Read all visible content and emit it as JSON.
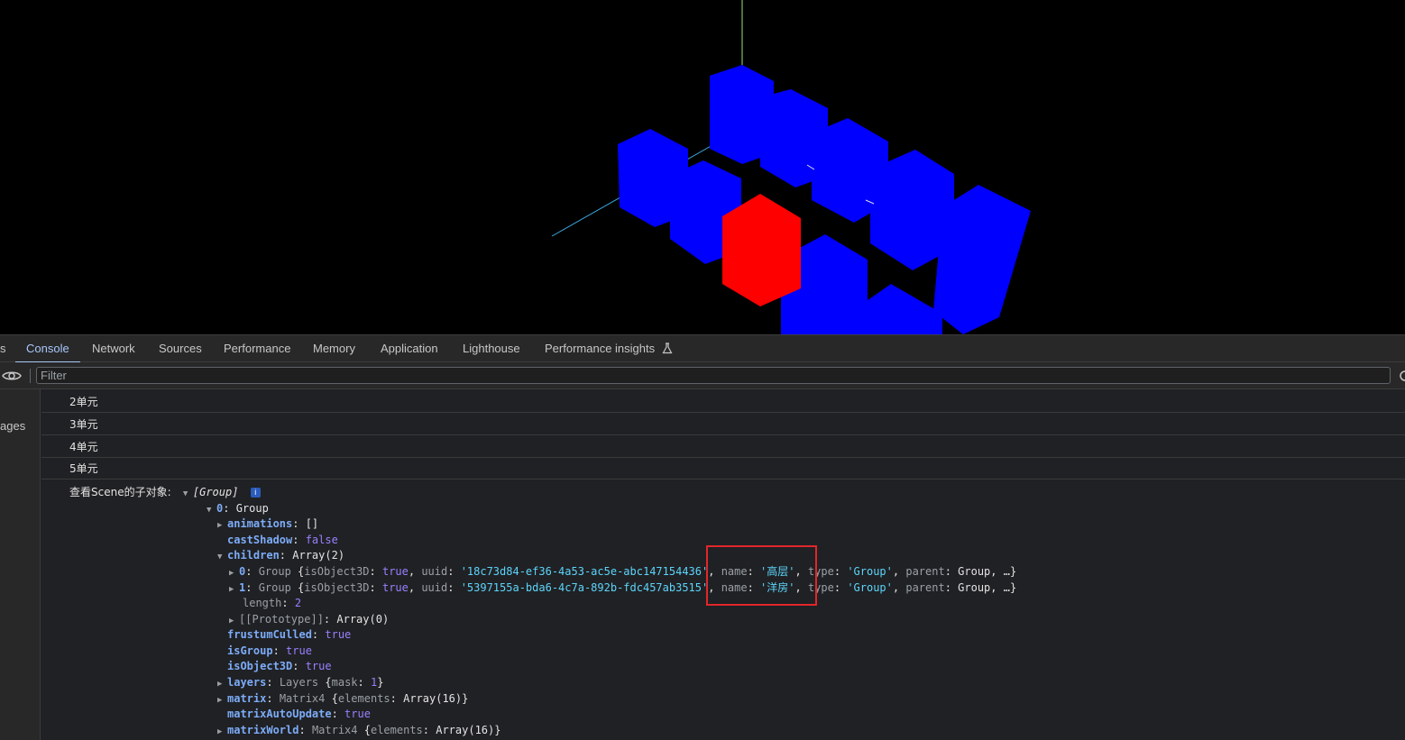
{
  "tabs": [
    {
      "label": "s"
    },
    {
      "label": "Console"
    },
    {
      "label": "Network"
    },
    {
      "label": "Sources"
    },
    {
      "label": "Performance"
    },
    {
      "label": "Memory"
    },
    {
      "label": "Application"
    },
    {
      "label": "Lighthouse"
    },
    {
      "label": "Performance insights"
    }
  ],
  "filter": {
    "placeholder": "Filter"
  },
  "sidebar": {
    "partial_label": "ages"
  },
  "messages": [
    "2单元",
    "3单元",
    "4单元",
    "5单元"
  ],
  "tree": {
    "root_label": "查看Scene的子对象:",
    "root_value": "[Group]",
    "info": "i",
    "item0_key": "0",
    "item0_value": "Group",
    "animations": {
      "key": "animations",
      "value": "[]"
    },
    "castShadow": {
      "key": "castShadow",
      "value": "false"
    },
    "children": {
      "key": "children",
      "value": "Array(2)"
    },
    "child0": {
      "index": "0",
      "type": "Group",
      "isObject3D": "true",
      "uuid": "'18c73d84-ef36-4a53-ac5e-abc147154436'",
      "name": "'高层'",
      "type_value": "'Group'",
      "parent": "Group",
      "ellipsis": "…}"
    },
    "child1": {
      "index": "1",
      "type": "Group",
      "isObject3D": "true",
      "uuid": "'5397155a-bda6-4c7a-892b-fdc457ab3515'",
      "name": "'洋房'",
      "type_value": "'Group'",
      "parent": "Group",
      "ellipsis": "…}"
    },
    "length": {
      "key": "length",
      "value": "2"
    },
    "prototype": {
      "key": "[[Prototype]]",
      "value": "Array(0)"
    },
    "frustumCulled": {
      "key": "frustumCulled",
      "value": "true"
    },
    "isGroup": {
      "key": "isGroup",
      "value": "true"
    },
    "isObject3D": {
      "key": "isObject3D",
      "value": "true"
    },
    "layers": {
      "key": "layers",
      "class": "Layers",
      "inner_key": "mask",
      "inner_value": "1"
    },
    "matrix": {
      "key": "matrix",
      "class": "Matrix4",
      "inner_key": "elements",
      "inner_value": "Array(16)"
    },
    "matrixAutoUpdate": {
      "key": "matrixAutoUpdate",
      "value": "true"
    },
    "matrixWorld": {
      "key": "matrixWorld",
      "class": "Matrix4",
      "inner_key": "elements",
      "inner_value": "Array(16)"
    }
  },
  "colors": {
    "cube_default": "#0000ff",
    "cube_selected": "#ff0000",
    "highlight": "#e1262b",
    "accent": "#a8c7fa"
  }
}
